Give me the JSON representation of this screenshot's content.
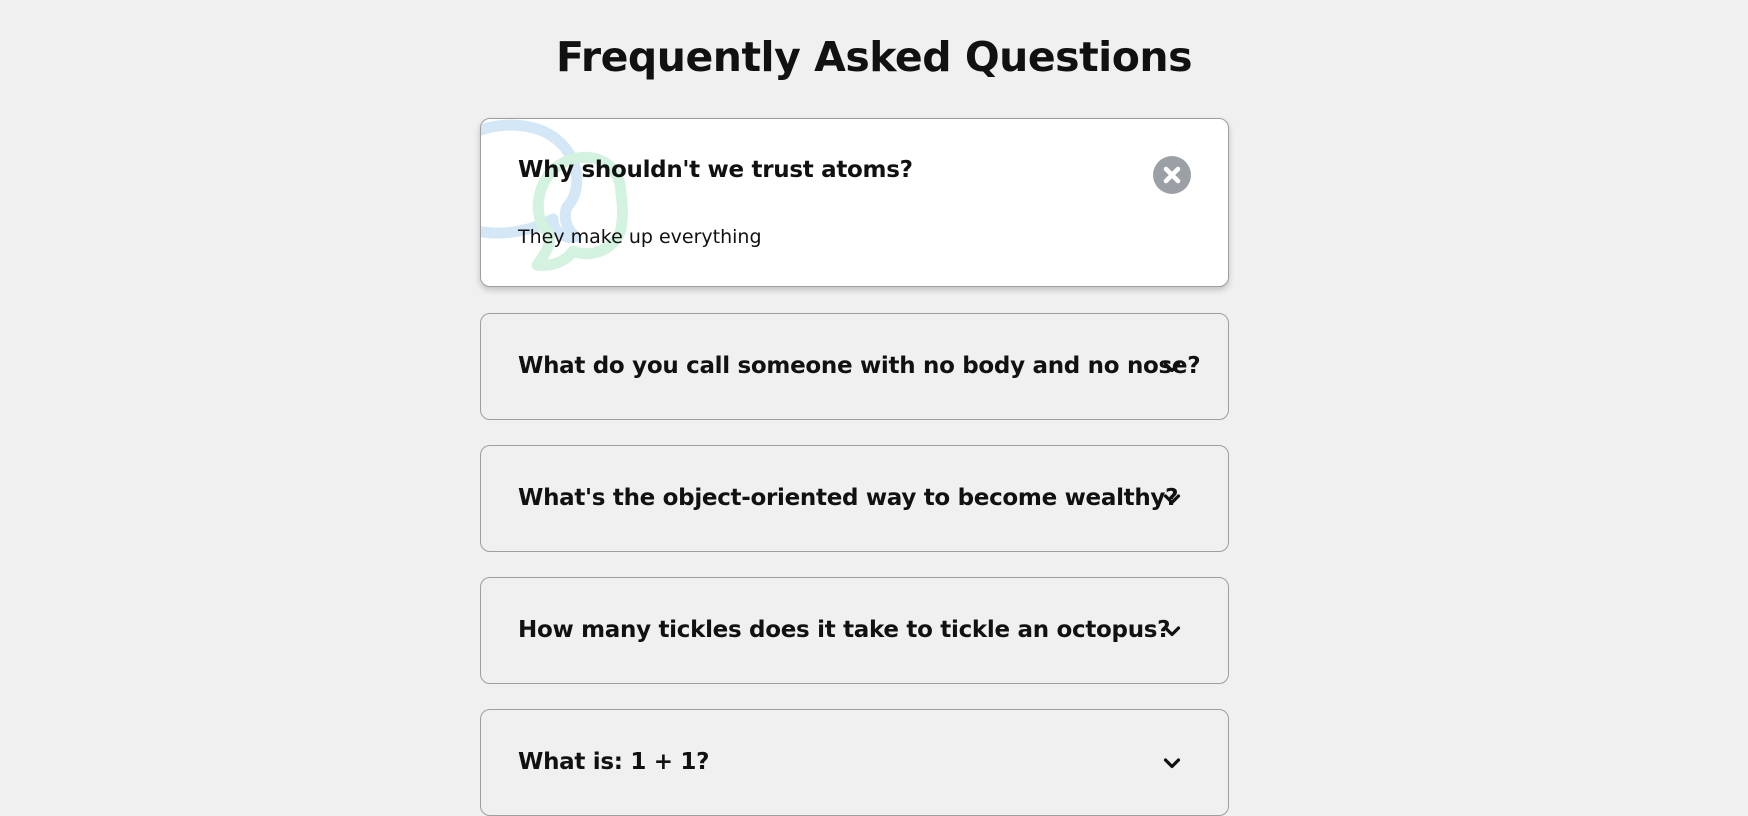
{
  "page": {
    "title": "Frequently Asked Questions"
  },
  "faqs": [
    {
      "question": "Why shouldn't we trust atoms?",
      "answer": "They make up everything",
      "expanded": true,
      "toggle_icon": "close-icon"
    },
    {
      "question": "What do you call someone with no body and no nose?",
      "expanded": false,
      "toggle_icon": "chevron-down-icon"
    },
    {
      "question": "What's the object-oriented way to become wealthy?",
      "expanded": false,
      "toggle_icon": "chevron-down-icon"
    },
    {
      "question": "How many tickles does it take to tickle an octopus?",
      "expanded": false,
      "toggle_icon": "chevron-down-icon"
    },
    {
      "question": "What is: 1 + 1?",
      "expanded": false,
      "toggle_icon": "chevron-down-icon"
    }
  ],
  "colors": {
    "background": "#f0f0f0",
    "active_card": "#ffffff",
    "border": "#9e9e9e",
    "close_button": "#9aa0a6",
    "bubble_blue": "#d3e7f7",
    "bubble_green": "#d3f2df"
  }
}
